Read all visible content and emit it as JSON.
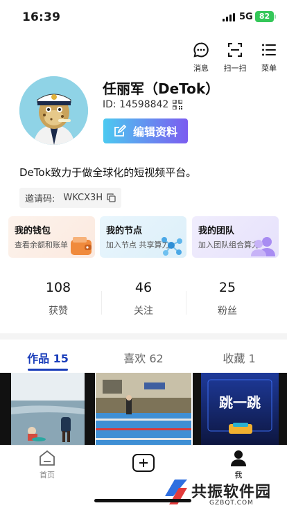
{
  "status": {
    "time": "16:39",
    "network": "5G",
    "battery": "82"
  },
  "actions": [
    {
      "label": "消息",
      "icon": "message-icon"
    },
    {
      "label": "扫一扫",
      "icon": "scan-icon"
    },
    {
      "label": "菜单",
      "icon": "menu-icon"
    }
  ],
  "profile": {
    "name": "任丽军（DeTok）",
    "id": "ID: 14598842",
    "edit_label": "编辑资料",
    "bio": "DeTok致力于做全球化的短视频平台。",
    "invite_label": "邀请码:",
    "invite_code": "WKCX3H"
  },
  "cards": [
    {
      "title": "我的钱包",
      "subtitle": "查看余额和账单"
    },
    {
      "title": "我的节点",
      "subtitle": "加入节点 共享算力"
    },
    {
      "title": "我的团队",
      "subtitle": "加入团队组合算力"
    }
  ],
  "stats": [
    {
      "value": "108",
      "label": "获赞"
    },
    {
      "value": "46",
      "label": "关注"
    },
    {
      "value": "25",
      "label": "粉丝"
    }
  ],
  "tabs": [
    {
      "label": "作品 15"
    },
    {
      "label": "喜欢 62"
    },
    {
      "label": "收藏 1"
    }
  ],
  "thumb3_text": "跳一跳",
  "bottom_nav": [
    {
      "label": "首页"
    },
    {
      "label": ""
    },
    {
      "label": "我"
    }
  ],
  "watermark": {
    "title": "共振软件园",
    "url": "GZBQT.COM"
  }
}
